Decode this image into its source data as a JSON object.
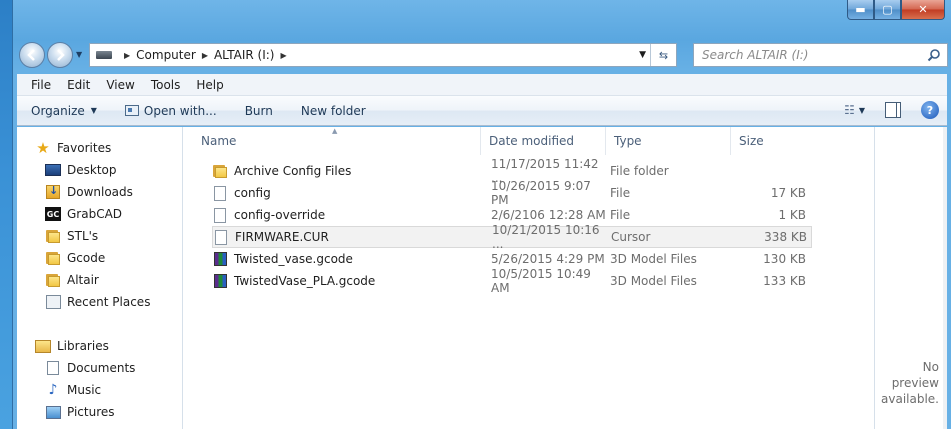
{
  "window": {
    "minimize_label": "▬",
    "maximize_label": "▢",
    "close_label": "✕"
  },
  "address": {
    "segments": [
      "Computer",
      "ALTAIR (I:)"
    ],
    "search_placeholder": "Search ALTAIR (I:)"
  },
  "menubar": {
    "items": [
      "File",
      "Edit",
      "View",
      "Tools",
      "Help"
    ]
  },
  "commands": {
    "organize": "Organize",
    "open_with": "Open with...",
    "burn": "Burn",
    "new_folder": "New folder"
  },
  "nav": {
    "favorites_label": "Favorites",
    "favorites": [
      "Desktop",
      "Downloads",
      "GrabCAD",
      "STL's",
      "Gcode",
      "Altair",
      "Recent Places"
    ],
    "libraries_label": "Libraries",
    "libraries": [
      "Documents",
      "Music",
      "Pictures"
    ]
  },
  "columns": {
    "name": "Name",
    "date": "Date modified",
    "type": "Type",
    "size": "Size"
  },
  "files": [
    {
      "name": "Archive Config Files",
      "date": "11/17/2015 11:42 ...",
      "type": "File folder",
      "size": "",
      "icon": "folder-icon"
    },
    {
      "name": "config",
      "date": "10/26/2015 9:07 PM",
      "type": "File",
      "size": "17 KB",
      "icon": "file-icon"
    },
    {
      "name": "config-override",
      "date": "2/6/2106 12:28 AM",
      "type": "File",
      "size": "1 KB",
      "icon": "file-icon"
    },
    {
      "name": "FIRMWARE.CUR",
      "date": "10/21/2015 10:16 ...",
      "type": "Cursor",
      "size": "338 KB",
      "icon": "file-icon",
      "selected": true
    },
    {
      "name": "Twisted_vase.gcode",
      "date": "5/26/2015 4:29 PM",
      "type": "3D Model Files",
      "size": "130 KB",
      "icon": "gcode-icon"
    },
    {
      "name": "TwistedVase_PLA.gcode",
      "date": "10/5/2015 10:49 AM",
      "type": "3D Model Files",
      "size": "133 KB",
      "icon": "gcode-icon"
    }
  ],
  "preview": {
    "line1": "No preview",
    "line2": "available."
  }
}
